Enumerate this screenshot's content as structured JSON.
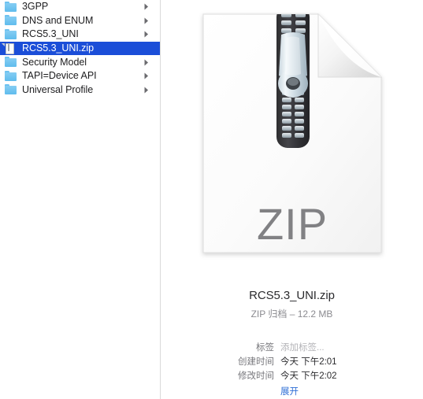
{
  "window": {
    "title": "RCS5.3_UNI.zip",
    "view_mode": "column-view",
    "selection_color": "#1b4ed8",
    "link_color": "#2f6fd6"
  },
  "column_list": {
    "items": [
      {
        "label": "3GPP",
        "icon": "folder-icon",
        "has_chevron": true,
        "selected": false
      },
      {
        "label": "DNS and ENUM",
        "icon": "folder-icon",
        "has_chevron": true,
        "selected": false
      },
      {
        "label": "RCS5.3_UNI",
        "icon": "folder-icon",
        "has_chevron": true,
        "selected": false
      },
      {
        "label": "RCS5.3_UNI.zip",
        "icon": "document-icon",
        "has_chevron": false,
        "selected": true
      },
      {
        "label": "Security Model",
        "icon": "folder-icon",
        "has_chevron": true,
        "selected": false
      },
      {
        "label": "TAPI=Device API",
        "icon": "folder-icon",
        "has_chevron": true,
        "selected": false
      },
      {
        "label": "Universal Profile",
        "icon": "folder-icon",
        "has_chevron": true,
        "selected": false
      }
    ]
  },
  "preview": {
    "icon": {
      "name": "zip-archive-icon",
      "badge_text": "ZIP",
      "badge_color": "#6d6d70",
      "page_color": "#fbfbfb",
      "zipper_color": "#3a3a3c"
    },
    "file_name": "RCS5.3_UNI.zip",
    "file_kind_size": "ZIP 归档 – 12.2 MB",
    "metadata": [
      {
        "label": "标签",
        "value": "添加标签...",
        "style": "placeholder"
      },
      {
        "label": "创建时间",
        "value": "今天 下午2:01",
        "style": "normal"
      },
      {
        "label": "修改时间",
        "value": "今天 下午2:02",
        "style": "normal"
      }
    ],
    "expand_label": "展开"
  }
}
